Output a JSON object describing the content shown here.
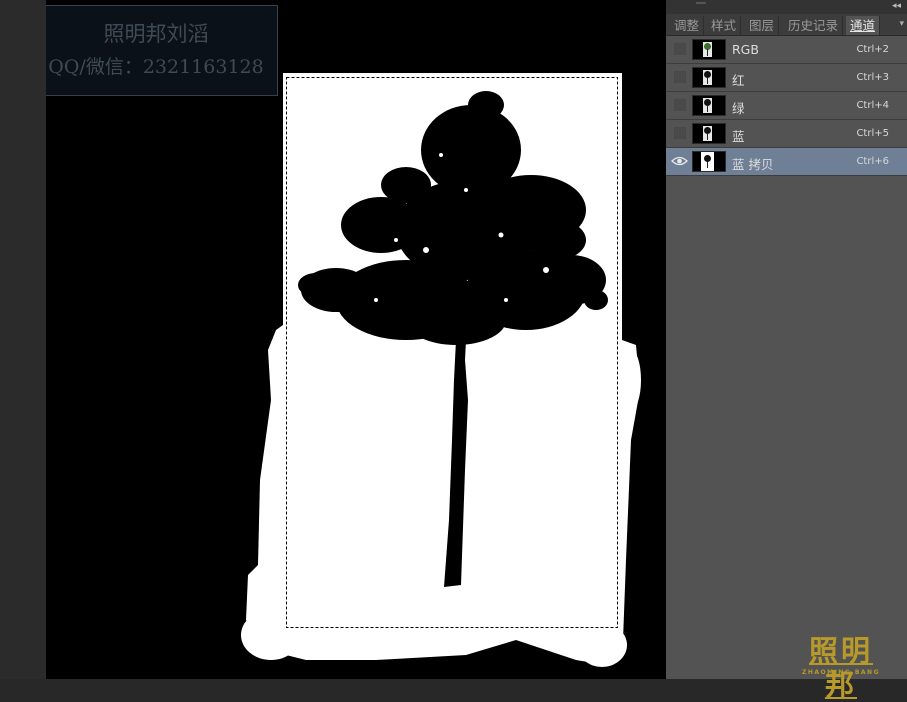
{
  "watermark": {
    "line1": "照明邦刘滔",
    "line2": "QQ/微信：2321163128"
  },
  "channels_panel": {
    "tabs": [
      {
        "label": "调整",
        "active": false
      },
      {
        "label": "样式",
        "active": false
      },
      {
        "label": "图层",
        "active": false
      },
      {
        "label": "历史记录",
        "active": false
      },
      {
        "label": "通道",
        "active": true
      }
    ],
    "channels": [
      {
        "name": "RGB",
        "shortcut": "Ctrl+2",
        "visible": false,
        "selected": false
      },
      {
        "name": "红",
        "shortcut": "Ctrl+3",
        "visible": false,
        "selected": false
      },
      {
        "name": "绿",
        "shortcut": "Ctrl+4",
        "visible": false,
        "selected": false
      },
      {
        "name": "蓝",
        "shortcut": "Ctrl+5",
        "visible": false,
        "selected": false
      },
      {
        "name": "蓝 拷贝",
        "shortcut": "Ctrl+6",
        "visible": true,
        "selected": true
      }
    ]
  },
  "logo": {
    "text": "照明邦",
    "subtext": "ZHAOMING BANG"
  },
  "colors": {
    "selected_row": "#6f7f95",
    "panel_bg": "#535353",
    "logo_gold": "#b89a2a"
  }
}
